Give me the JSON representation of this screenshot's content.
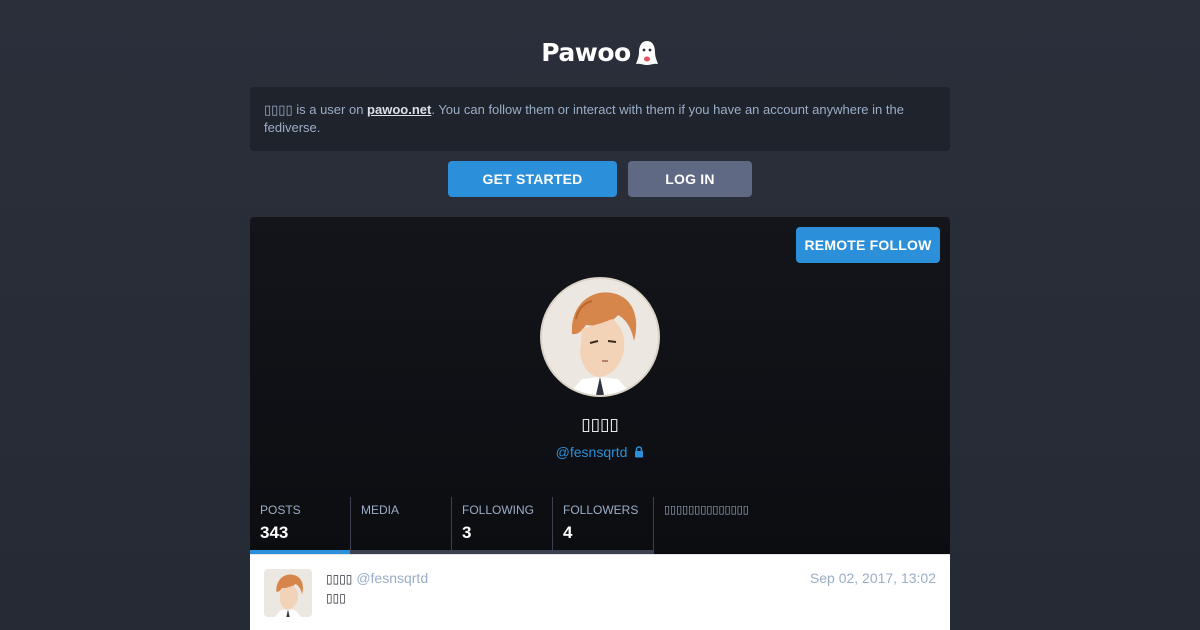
{
  "site": {
    "logo_text": "Pawoo"
  },
  "notice": {
    "prefix": "▯▯▯▯ is a user on ",
    "link": "pawoo.net",
    "suffix": ". You can follow them or interact with them if you have an account anywhere in the fediverse."
  },
  "buttons": {
    "get_started": "GET STARTED",
    "log_in": "LOG IN",
    "remote_follow": "REMOTE FOLLOW"
  },
  "profile": {
    "display_name": "▯▯▯▯",
    "handle": "@fesnsqrtd",
    "locked": true
  },
  "counters": {
    "posts_label": "POSTS",
    "posts_value": "343",
    "media_label": "MEDIA",
    "media_value": "",
    "following_label": "FOLLOWING",
    "following_value": "3",
    "followers_label": "FOLLOWERS",
    "followers_value": "4",
    "extra_text": "▯▯▯▯▯▯▯▯▯▯▯▯▯▯"
  },
  "status": {
    "display_name": "▯▯▯▯",
    "acct": "@fesnsqrtd",
    "timestamp": "Sep 02, 2017, 13:02",
    "content": "▯▯▯"
  },
  "colors": {
    "accent": "#2b90d9",
    "secondary_button": "#606984",
    "background": "#282c37"
  }
}
